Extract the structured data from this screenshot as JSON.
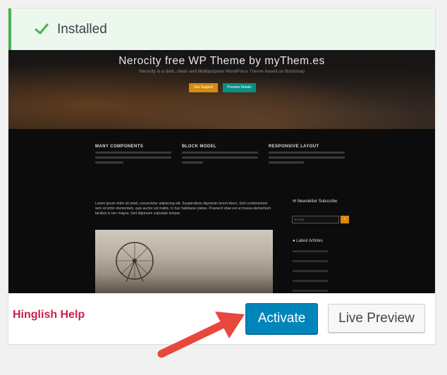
{
  "notice": {
    "text": "Installed",
    "icon": "check-icon",
    "accent": "#46b450"
  },
  "preview": {
    "title": "Nerocity free WP Theme by myThem.es",
    "subtitle": "Nerocity is a dark, clean and Multipurpose WordPress Theme based on Bootstrap",
    "buttons": [
      "Get Support",
      "Preview Details"
    ],
    "features": [
      "MANY COMPONENTS",
      "BLOCK MODEL",
      "RESPONSIVE LAYOUT"
    ],
    "lorem": "Lorem ipsum dolor sit amet, consectetur adipiscing elit. Suspendisse dignissim lorem libero. Sed condimentum sem at tortor elementum, quis auctor est mattis. In hac habitasse platea. Praesent vitae est at massa elementum facilisis in nec magna. Sed dignissim vulputate tempor.",
    "sidebar": {
      "newsletter": "Newsletter Subscribe",
      "email_placeholder": "E-mail",
      "go": "›",
      "latest": "Latest Articles"
    }
  },
  "footer": {
    "label": "Hinglish Help",
    "activate": "Activate",
    "live_preview": "Live Preview"
  },
  "colors": {
    "primary": "#0085ba",
    "brand_label": "#c8204d",
    "arrow": "#e8473d"
  }
}
